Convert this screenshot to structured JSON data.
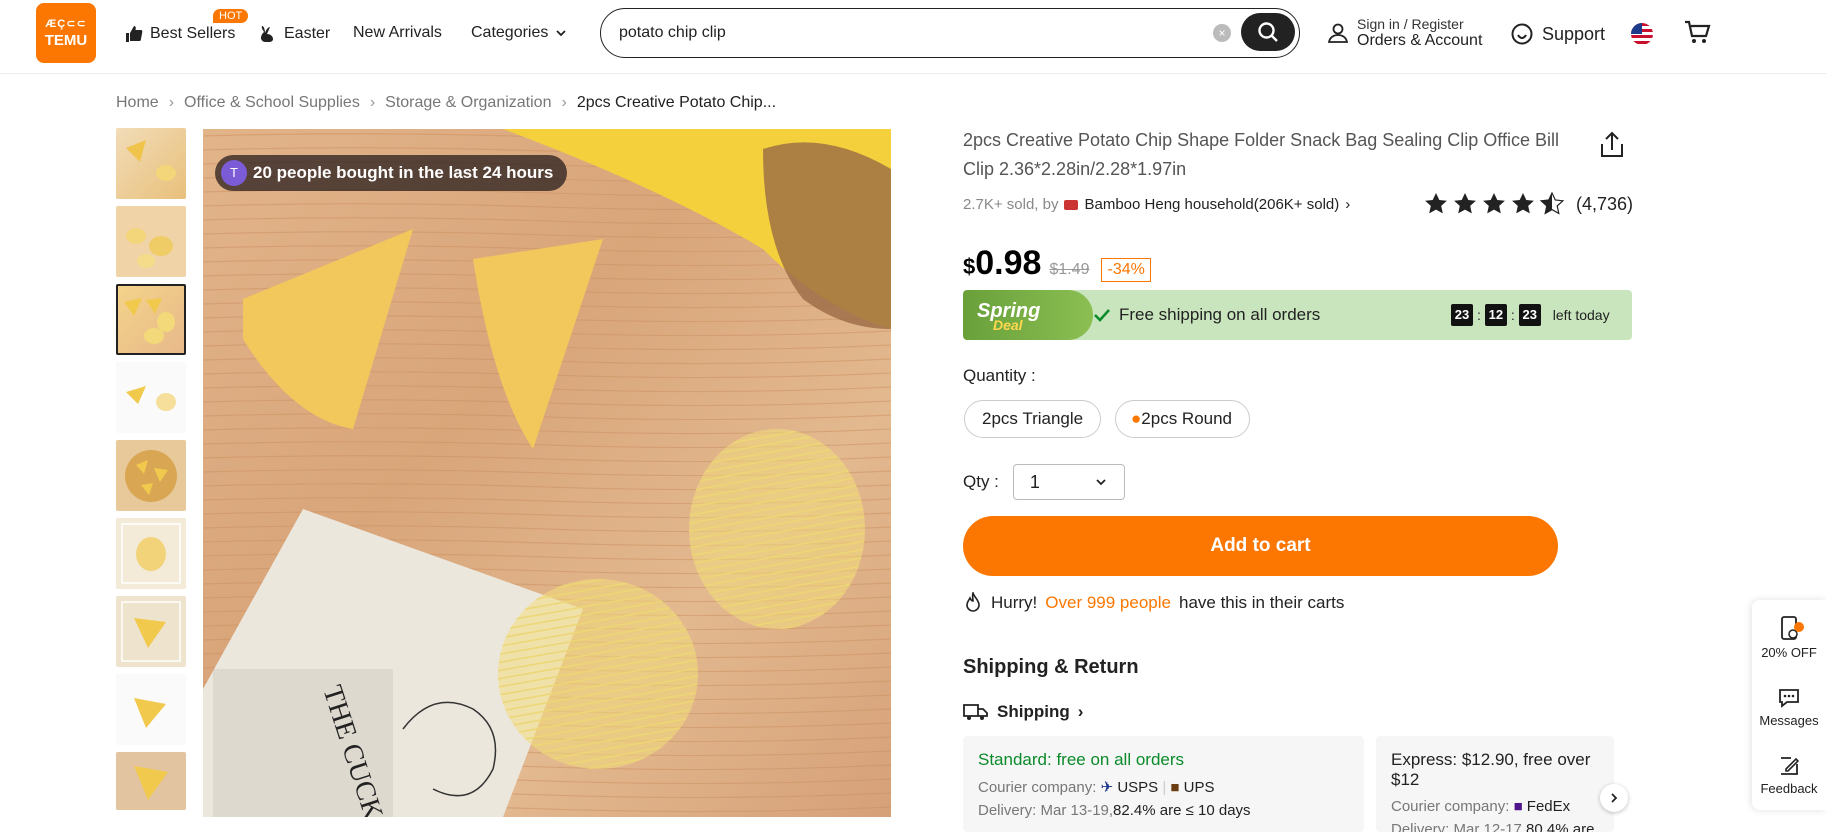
{
  "header": {
    "logo_line1": "ÆÇ⊂⊂",
    "logo_line2": "TEMU",
    "nav": [
      "Best Sellers",
      "Easter",
      "New Arrivals",
      "Categories"
    ],
    "hot_badge": "HOT",
    "search_value": "potato chip clip",
    "account_line1": "Sign in / Register",
    "account_line2": "Orders & Account",
    "support": "Support"
  },
  "breadcrumb": [
    "Home",
    "Office & School Supplies",
    "Storage & Organization",
    "2pcs Creative Potato Chip..."
  ],
  "badge": {
    "avatar": "T",
    "text": "20 people bought in the last 24 hours"
  },
  "product": {
    "title": "2pcs Creative Potato Chip Shape Folder Snack Bag Sealing Clip Office Bill Clip 2.36*2.28in/2.28*1.97in",
    "sold": "2.7K+ sold, by",
    "store": "Bamboo Heng household(206K+ sold)",
    "rating": 4.5,
    "reviews": "(4,736)",
    "currency": "$",
    "price": "0.98",
    "old_price": "$1.49",
    "discount": "-34%"
  },
  "deal": {
    "tag": "Spring",
    "tag2": "Deal",
    "shipping": "Free shipping on all orders",
    "hh": "23",
    "mm": "12",
    "ss": "23",
    "left": "left today"
  },
  "quantity": {
    "label": "Quantity :",
    "options": [
      "2pcs Triangle",
      "2pcs Round"
    ],
    "qty_label": "Qty :",
    "qty_value": "1"
  },
  "add_to_cart": "Add to cart",
  "hurry": {
    "a": "Hurry!",
    "b": "Over 999 people",
    "c": "have this in their carts"
  },
  "shipping_return": "Shipping & Return",
  "shipping_link": "Shipping",
  "cards": [
    {
      "head": "Standard: free on all orders",
      "courier_label": "Courier company:",
      "couriers": [
        "USPS",
        "UPS"
      ],
      "delivery_label": "Delivery: Mar 13-19,",
      "delivery_stat": "82.4% are ≤ 10 days"
    },
    {
      "head": "Express: $12.90, free over $12",
      "courier_label": "Courier company:",
      "couriers": [
        "FedEx"
      ],
      "delivery_label": "Delivery: Mar 12-17,",
      "delivery_stat": "80.4% are"
    }
  ],
  "side": {
    "offer": "20% OFF",
    "messages": "Messages",
    "feedback": "Feedback"
  },
  "colors": {
    "accent": "#fb7701",
    "deal_bg": "#c9e5bd",
    "green": "#0a8a2a"
  }
}
